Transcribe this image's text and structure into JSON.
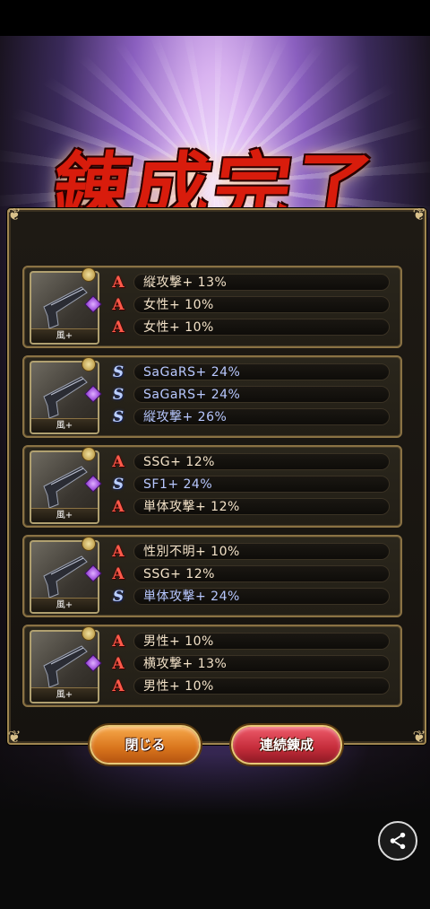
{
  "title": "錬成完了",
  "cards": [
    {
      "element": "風+",
      "options": [
        {
          "rank": "A",
          "text": "縦攻撃+ 13%"
        },
        {
          "rank": "A",
          "text": "女性+ 10%"
        },
        {
          "rank": "A",
          "text": "女性+ 10%"
        }
      ]
    },
    {
      "element": "風+",
      "options": [
        {
          "rank": "S",
          "text": "SaGaRS+ 24%"
        },
        {
          "rank": "S",
          "text": "SaGaRS+ 24%"
        },
        {
          "rank": "S",
          "text": "縦攻撃+ 26%"
        }
      ]
    },
    {
      "element": "風+",
      "options": [
        {
          "rank": "A",
          "text": "SSG+ 12%"
        },
        {
          "rank": "S",
          "text": "SF1+ 24%"
        },
        {
          "rank": "A",
          "text": "単体攻撃+ 12%"
        }
      ]
    },
    {
      "element": "風+",
      "options": [
        {
          "rank": "A",
          "text": "性別不明+ 10%"
        },
        {
          "rank": "A",
          "text": "SSG+ 12%"
        },
        {
          "rank": "S",
          "text": "単体攻撃+ 24%"
        }
      ]
    },
    {
      "element": "風+",
      "options": [
        {
          "rank": "A",
          "text": "男性+ 10%"
        },
        {
          "rank": "A",
          "text": "横攻撃+ 13%"
        },
        {
          "rank": "A",
          "text": "男性+ 10%"
        }
      ]
    }
  ],
  "buttons": {
    "close": "閉じる",
    "repeat": "連続錬成"
  },
  "icons": {
    "share": "share-icon",
    "weapon": "pistol-icon"
  },
  "colors": {
    "rank_A": "#ff5a4a",
    "rank_S": "#bcd0ff",
    "frame_gold": "#a08650"
  }
}
